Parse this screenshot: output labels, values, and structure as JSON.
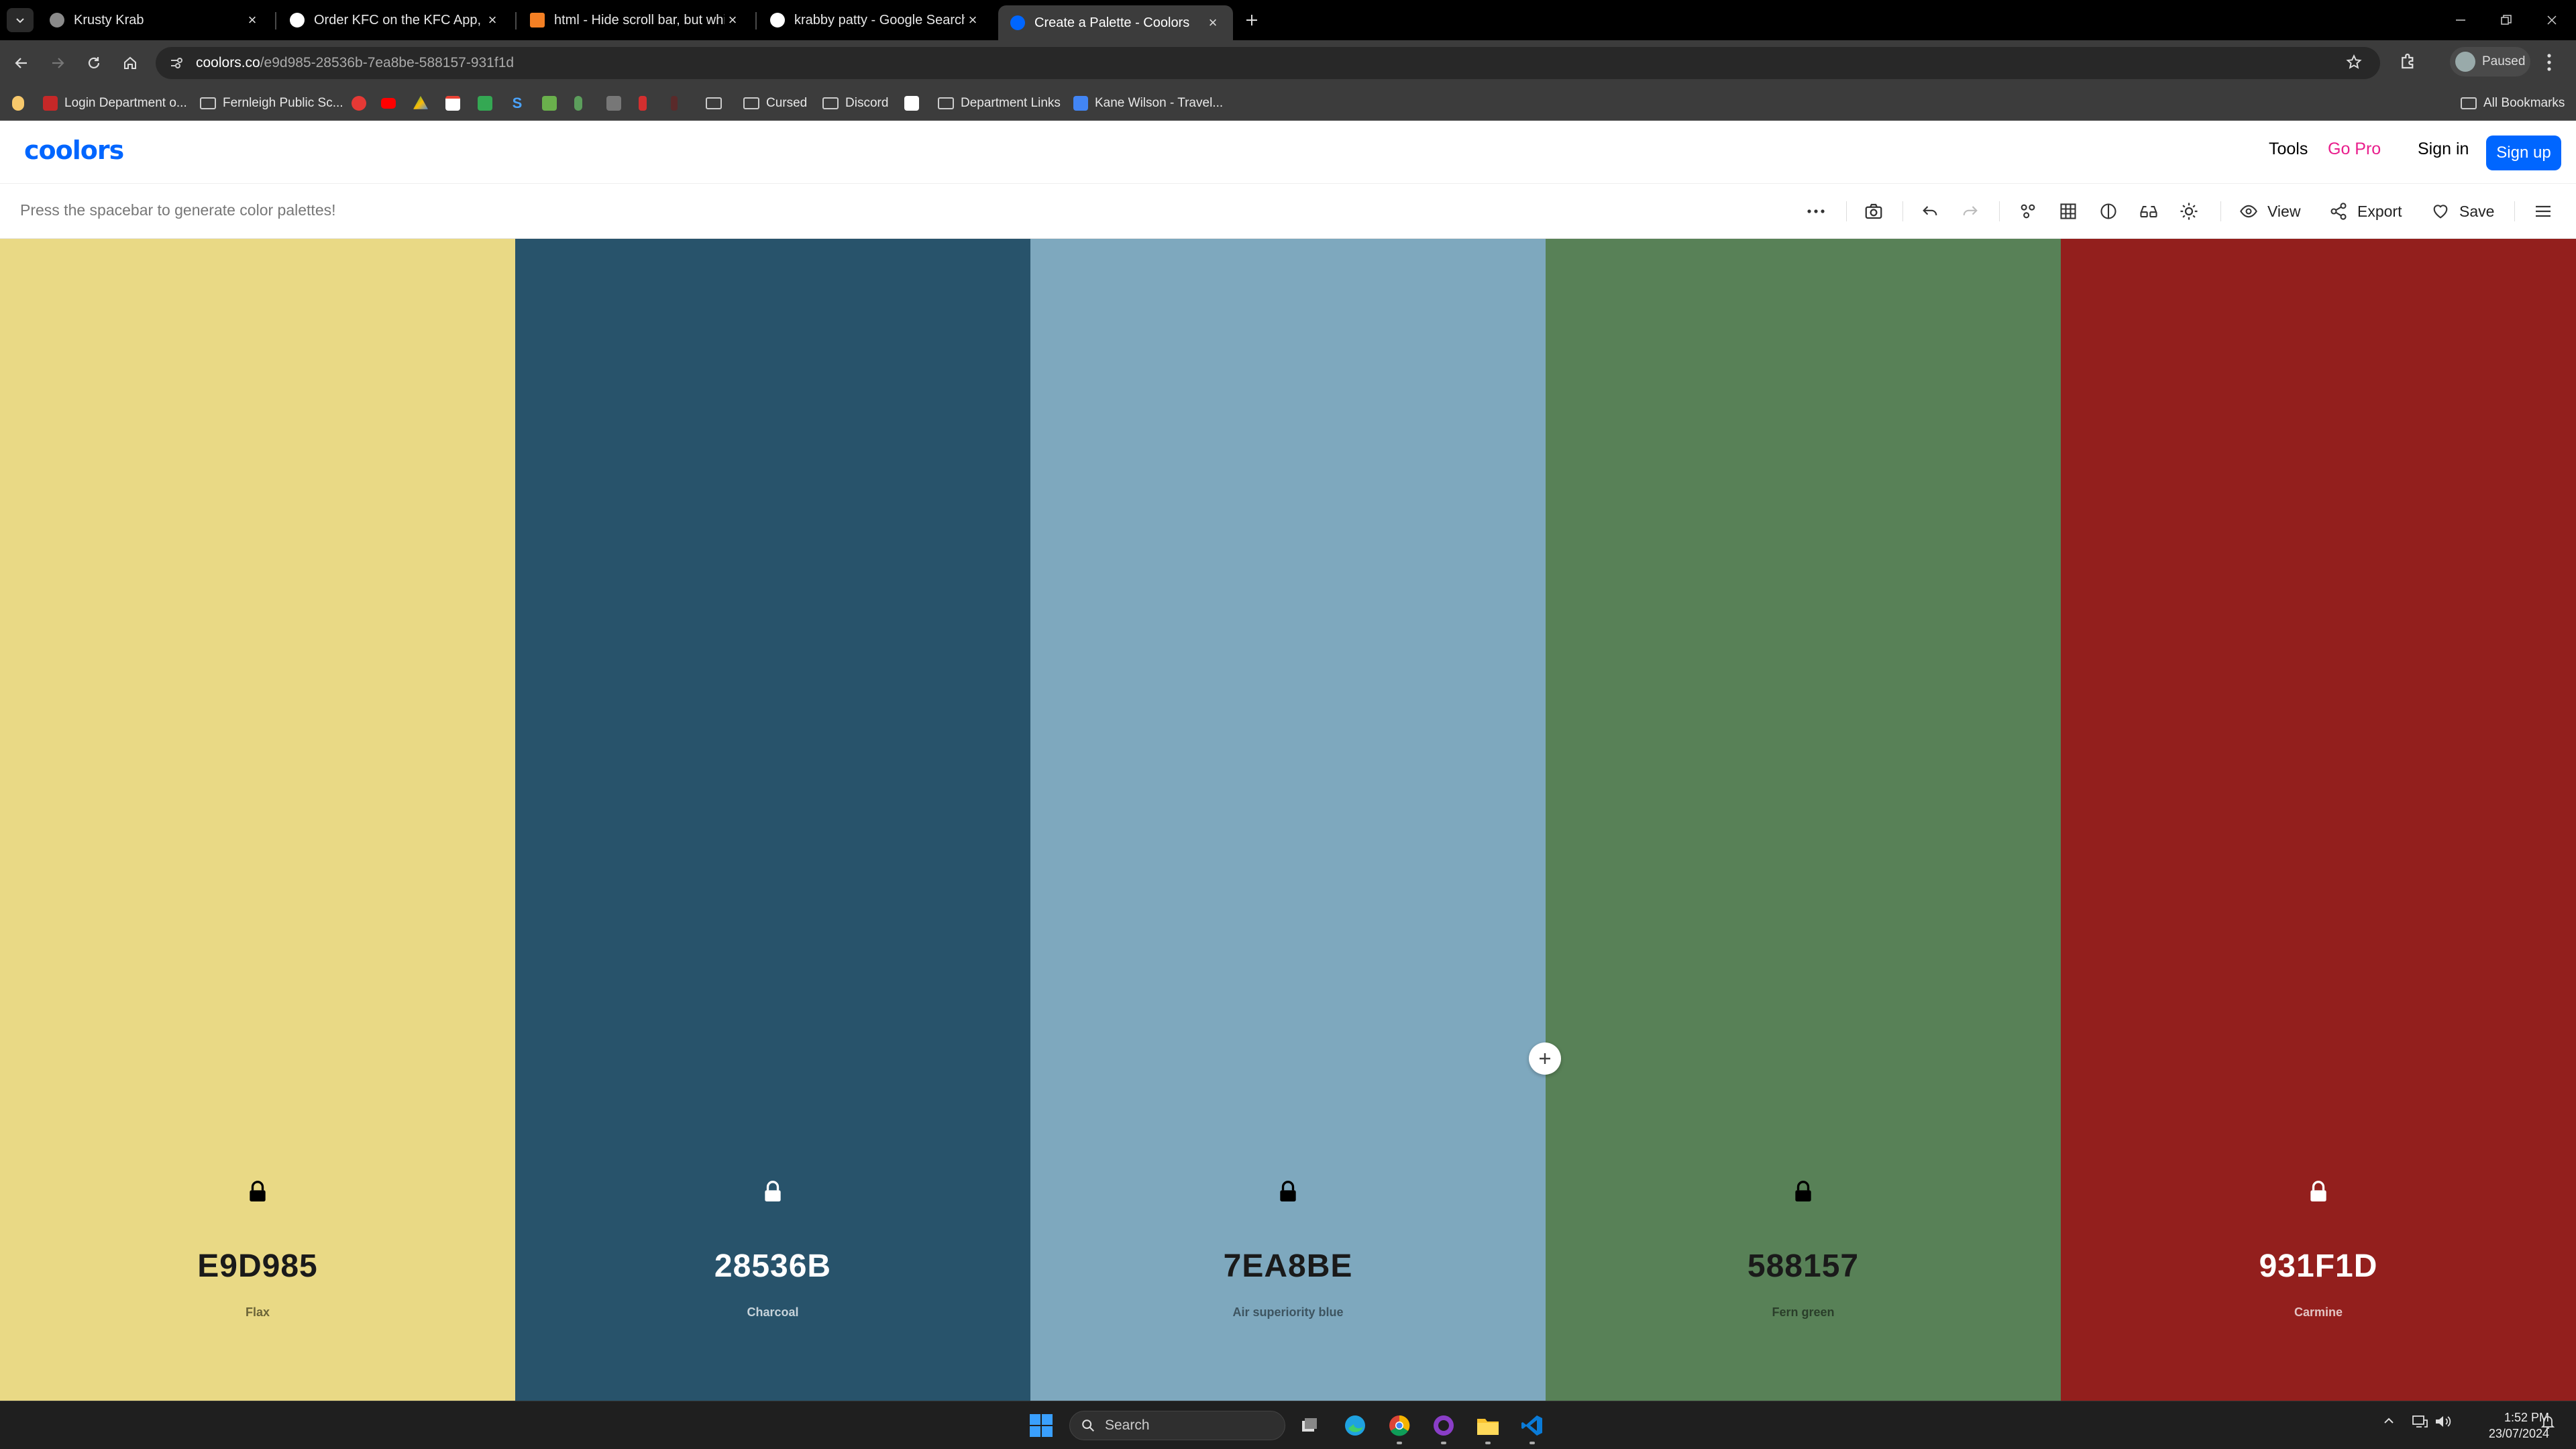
{
  "browser": {
    "tabs": [
      {
        "title": "Krusty Krab",
        "active": false,
        "favicon_color": "#8a8a8a"
      },
      {
        "title": "Order KFC on the KFC App, Dri",
        "active": false,
        "favicon_color": "#ffffff"
      },
      {
        "title": "html - Hide scroll bar, but while",
        "active": false,
        "favicon_color": "#f48024"
      },
      {
        "title": "krabby patty - Google Search",
        "active": false,
        "favicon_color": "#ffffff"
      },
      {
        "title": "Create a Palette - Coolors",
        "active": true,
        "favicon_color": "#0066ff"
      }
    ],
    "url_host": "coolors.co",
    "url_path": "/e9d985-28536b-7ea8be-588157-931f1d",
    "profile_status": "Paused",
    "bookmarks": [
      {
        "label": "Login Department o...",
        "icon": "site-icon",
        "color": "#c62828"
      },
      {
        "label": "Fernleigh Public Sc...",
        "icon": "folder-icon"
      },
      {
        "label": "Cursed",
        "icon": "folder-icon"
      },
      {
        "label": "Discord",
        "icon": "folder-icon"
      },
      {
        "label": "Department Links",
        "icon": "folder-icon"
      },
      {
        "label": "Kane Wilson - Travel...",
        "icon": "docs-icon",
        "color": "#4285f4"
      }
    ],
    "all_bookmarks_label": "All Bookmarks"
  },
  "header": {
    "logo": "coolors",
    "tools": "Tools",
    "go_pro": "Go Pro",
    "sign_in": "Sign in",
    "sign_up": "Sign up"
  },
  "toolbar": {
    "hint": "Press the spacebar to generate color palettes!",
    "view": "View",
    "export": "Export",
    "save": "Save"
  },
  "palette": [
    {
      "hex": "E9D985",
      "name": "Flax",
      "color": "#E9D985",
      "text_color": "#1a1a1a",
      "name_color": "#6b6438"
    },
    {
      "hex": "28536B",
      "name": "Charcoal",
      "color": "#28536B",
      "text_color": "#ffffff",
      "name_color": "#c7d3da"
    },
    {
      "hex": "7EA8BE",
      "name": "Air superiority blue",
      "color": "#7EA8BE",
      "text_color": "#1a1a1a",
      "name_color": "#3d5460"
    },
    {
      "hex": "588157",
      "name": "Fern green",
      "color": "#588157",
      "text_color": "#1a1a1a",
      "name_color": "#2a3e2a"
    },
    {
      "hex": "931F1D",
      "name": "Carmine",
      "color": "#931F1D",
      "text_color": "#ffffff",
      "name_color": "#e3c4c3"
    }
  ],
  "taskbar": {
    "search_placeholder": "Search",
    "time": "1:52 PM",
    "date": "23/07/2024"
  }
}
